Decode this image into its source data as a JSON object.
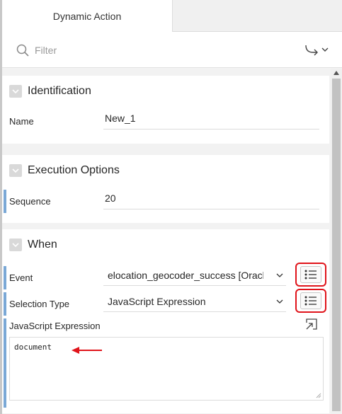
{
  "tabs": [
    {
      "label": "Dynamic Action",
      "active": true
    }
  ],
  "filter": {
    "placeholder": "Filter"
  },
  "icons": {
    "search": "search-icon",
    "goto": "goto-arrow-icon",
    "collapse": "chevron-down-icon",
    "list": "list-icon",
    "expand": "expand-icon"
  },
  "sections": {
    "identification": {
      "title": "Identification",
      "name_label": "Name",
      "name_value": "New_1"
    },
    "execution": {
      "title": "Execution Options",
      "sequence_label": "Sequence",
      "sequence_value": "20"
    },
    "when": {
      "title": "When",
      "event_label": "Event",
      "event_value": "elocation_geocoder_success [Oracl",
      "selection_type_label": "Selection Type",
      "selection_type_value": "JavaScript Expression",
      "js_label": "JavaScript Expression",
      "js_value": "document"
    }
  },
  "colors": {
    "changed_marker": "#7aa8d6",
    "highlight": "#e0141b"
  }
}
